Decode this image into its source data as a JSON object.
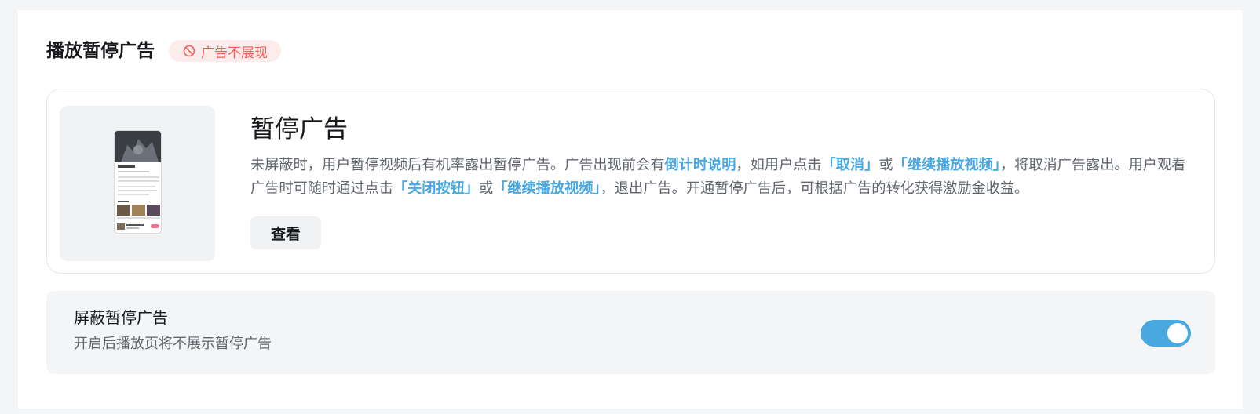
{
  "section": {
    "title": "播放暂停广告",
    "badge": {
      "label": "广告不展现",
      "icon": "prohibited-icon",
      "color": "#f25d59"
    }
  },
  "card": {
    "title": "暂停广告",
    "desc": {
      "p1": "未屏蔽时，用户暂停视频后有机率露出暂停广告。广告出现前会有",
      "hl1": "倒计时说明",
      "p2": "，如用户点击",
      "hl2": "「取消」",
      "p3": "或",
      "hl3": "「继续播放视频」",
      "p4": "，将取消广告露出。用户观看广告时可随时通过点击",
      "hl4": "「关闭按钮」",
      "p5": "或",
      "hl5": "「继续播放视频」",
      "p6": "，退出广告。开通暂停广告后，可根据广告的转化获得激励金收益。"
    },
    "view_button": "查看"
  },
  "setting": {
    "title": "屏蔽暂停广告",
    "subtitle": "开启后播放页将不展示暂停广告",
    "toggle_on": true
  },
  "colors": {
    "accent": "#4aa8e0",
    "warning": "#f25d59",
    "badge_bg": "#fdecec"
  }
}
